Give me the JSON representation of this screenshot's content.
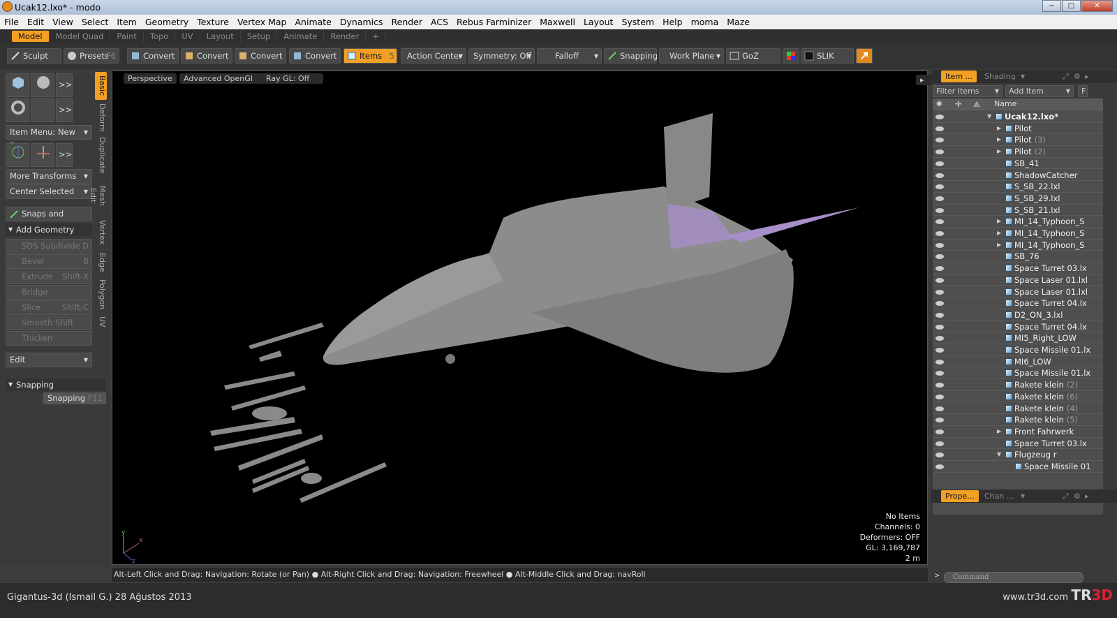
{
  "window": {
    "title": "Ucak12.lxo* - modo",
    "min": "−",
    "max": "□",
    "close": "✕"
  },
  "menu": [
    "File",
    "Edit",
    "View",
    "Select",
    "Item",
    "Geometry",
    "Texture",
    "Vertex Map",
    "Animate",
    "Dynamics",
    "Render",
    "ACS",
    "Rebus Farminizer",
    "Maxwell",
    "Layout",
    "System",
    "Help",
    "moma",
    "Maze"
  ],
  "layout_tabs": [
    "Model",
    "Model Quad",
    "Paint",
    "Topo",
    "UV",
    "Layout",
    "Setup",
    "Animate",
    "Render",
    "+"
  ],
  "toolbar": {
    "sculpt": "Sculpt",
    "presets": "Presets",
    "presets_key": "F6",
    "convert": "Convert",
    "items": "Items",
    "items_key": "5",
    "action_center": "Action Center",
    "symmetry": "Symmetry: Off",
    "falloff": "Falloff",
    "snapping": "Snapping",
    "work_plane": "Work Plane",
    "goz": "GoZ",
    "slik": "SLIK"
  },
  "left": {
    "more": ">>",
    "item_menu": "Item Menu: New Item",
    "more_transforms": "More Transforms",
    "center_selected": "Center Selected",
    "snaps_precision": "Snaps and Precision",
    "add_geometry": "Add Geometry",
    "tools": [
      {
        "label": "SDS Subdivide",
        "key": "D"
      },
      {
        "label": "Bevel",
        "key": "B"
      },
      {
        "label": "Extrude",
        "key": "Shift-X"
      },
      {
        "label": "Bridge",
        "key": ""
      },
      {
        "label": "Slice",
        "key": "Shift-C"
      },
      {
        "label": "Smooth Shift",
        "key": ""
      },
      {
        "label": "Thicken",
        "key": ""
      }
    ],
    "edit": "Edit",
    "snapping_hdr": "Snapping",
    "snapping_btn": "Snapping",
    "snapping_key": "F11"
  },
  "vtabs": [
    "Basic",
    "Deform",
    "Duplicate",
    "Mesh Edit",
    "Vertex",
    "Edge",
    "Polygon",
    "UV"
  ],
  "viewport": {
    "perspective": "Perspective",
    "opengl": "Advanced OpenGL",
    "raygl": "Ray GL: Off",
    "info": [
      "No Items",
      "Channels: 0",
      "Deformers: OFF",
      "GL: 3,169,787",
      "2 m"
    ],
    "axis_x": "x",
    "axis_y": "y",
    "axis_z": "z"
  },
  "status": "Alt-Left Click and Drag: Navigation: Rotate (or Pan) ●  Alt-Right Click and Drag: Navigation: Freewheel ●  Alt-Middle Click and Drag: navRoll",
  "credit": "Gigantus-3d (Ismail G.)  28 Ağustos 2013",
  "site": "www.tr3d.com",
  "logo": {
    "a": "TR",
    "b": "3D"
  },
  "right": {
    "tab_item": "Item ...",
    "tab_shading": "Shading",
    "filter": "Filter Items",
    "add_item": "Add Item",
    "f": "F",
    "name_col": "Name",
    "tab_props": "Prope...",
    "tab_chan": "Chan ...",
    "command": "Command",
    "items": [
      {
        "label": "Ucak12.lxo*",
        "num": "",
        "sel": true,
        "arrow": "▼",
        "indent": 0
      },
      {
        "label": "Pilot",
        "num": "",
        "arrow": "▶",
        "indent": 1
      },
      {
        "label": "Pilot",
        "num": "(3)",
        "arrow": "▶",
        "indent": 1
      },
      {
        "label": "Pilot",
        "num": "(2)",
        "arrow": "▶",
        "indent": 1
      },
      {
        "label": "SB_41",
        "num": "",
        "arrow": "",
        "indent": 1
      },
      {
        "label": "ShadowCatcher",
        "num": "",
        "arrow": "",
        "indent": 1
      },
      {
        "label": "S_SB_22.lxl",
        "num": "",
        "arrow": "",
        "indent": 1
      },
      {
        "label": "S_SB_29.lxl",
        "num": "",
        "arrow": "",
        "indent": 1
      },
      {
        "label": "S_SB_21.lxl",
        "num": "",
        "arrow": "",
        "indent": 1
      },
      {
        "label": "MI_14_Typhoon_S",
        "num": "",
        "arrow": "▶",
        "indent": 1
      },
      {
        "label": "MI_14_Typhoon_S",
        "num": "",
        "arrow": "▶",
        "indent": 1
      },
      {
        "label": "MI_14_Typhoon_S",
        "num": "",
        "arrow": "▶",
        "indent": 1
      },
      {
        "label": "SB_76",
        "num": "",
        "arrow": "",
        "indent": 1
      },
      {
        "label": "Space Turret 03.lx",
        "num": "",
        "arrow": "",
        "indent": 1
      },
      {
        "label": "Space Laser 01.lxl",
        "num": "",
        "arrow": "",
        "indent": 1
      },
      {
        "label": "Space Laser 01.lxl",
        "num": "",
        "arrow": "",
        "indent": 1
      },
      {
        "label": "Space Turret 04.lx",
        "num": "",
        "arrow": "",
        "indent": 1
      },
      {
        "label": "D2_ON_3.lxl",
        "num": "",
        "arrow": "",
        "indent": 1
      },
      {
        "label": "Space Turret 04.lx",
        "num": "",
        "arrow": "",
        "indent": 1
      },
      {
        "label": "MI5_Right_LOW",
        "num": "",
        "arrow": "",
        "indent": 1
      },
      {
        "label": "Space Missile 01.lx",
        "num": "",
        "arrow": "",
        "indent": 1
      },
      {
        "label": "MI6_LOW",
        "num": "",
        "arrow": "",
        "indent": 1
      },
      {
        "label": "Space Missile 01.lx",
        "num": "",
        "arrow": "",
        "indent": 1
      },
      {
        "label": "Rakete klein",
        "num": "(2)",
        "arrow": "",
        "indent": 1
      },
      {
        "label": "Rakete klein",
        "num": "(6)",
        "arrow": "",
        "indent": 1
      },
      {
        "label": "Rakete klein",
        "num": "(4)",
        "arrow": "",
        "indent": 1
      },
      {
        "label": "Rakete klein",
        "num": "(5)",
        "arrow": "",
        "indent": 1
      },
      {
        "label": "Front Fahrwerk",
        "num": "",
        "arrow": "▶",
        "indent": 1
      },
      {
        "label": "Space Turret 03.lx",
        "num": "",
        "arrow": "",
        "indent": 1
      },
      {
        "label": "Flugzeug r",
        "num": "",
        "arrow": "▼",
        "indent": 1
      },
      {
        "label": "Space Missile 01",
        "num": "",
        "arrow": "",
        "indent": 2
      }
    ]
  }
}
